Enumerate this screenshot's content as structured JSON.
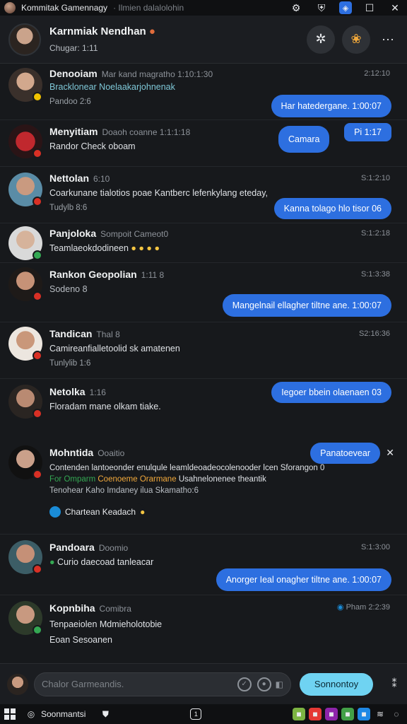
{
  "window": {
    "title": "Kommitak Gamennagy",
    "subtitle": "· Ilmien dalalolohin",
    "controls": [
      "gear-icon",
      "shield-icon",
      "compass-icon",
      "maximize-icon",
      "close-icon"
    ]
  },
  "header": {
    "name": "Karnmiak Nendhan",
    "status": "Chugar: 1:11",
    "actions": [
      "settings-icon",
      "sticker-icon",
      "more-icon"
    ],
    "more_glyph": "···"
  },
  "messages": [
    {
      "name": "Denooiam",
      "meta": "Mar kand magratho 1:10:1:30",
      "time": "2:12:10",
      "text": "Bracklonear Noelaakarjohnenak",
      "sub": "Pandoo 2:6",
      "reply": "Har hatedergane. 1:00:07"
    },
    {
      "name": "Menyitiam",
      "meta": "Doaoh coanne 1:1:1:18",
      "time": "",
      "text": "Randor Check oboam",
      "sub": "",
      "reply": "Camara",
      "reply2": "Pi 1:17"
    },
    {
      "name": "Nettolan",
      "meta": "6:10",
      "time": "S:1:2:10",
      "text": "Coarkunane tialotios poae Kantberc lefenkylang eteday,",
      "sub": "Tudylb 8:6",
      "reply": "Kanna tolago hlo tisor 06"
    },
    {
      "name": "Panjoloka",
      "meta": "Sompoit Cameot0",
      "time": "S:1:2:18",
      "text": "Teamlaeokdodineen",
      "sub": "",
      "reply": ""
    },
    {
      "name": "Rankon Geopolian",
      "meta": "1:11 8",
      "time": "S:1:3:38",
      "text": "Sodeno 8",
      "sub": "",
      "reply": "Mangelnail ellagher tiltne ane. 1:00:07"
    },
    {
      "name": "Tandican",
      "meta": "Thal 8",
      "time": "S2:16:36",
      "text": "Camireanfialletoolid sk amatenen",
      "sub": "Tunlylib 1:6",
      "reply": ""
    },
    {
      "name": "Netolka",
      "meta": "1:16",
      "time": "",
      "text": "Floradam mane olkam tiake.",
      "sub": "",
      "reply": "Iegoer bbein olaenaen 03"
    },
    {
      "name": "Mohntida",
      "meta": "Ooaitio",
      "time": "",
      "text": "Contenden lantoeonder enulqule leamldeoadeocolenooder lcen Sforangon 0",
      "line2a": "For Omparm",
      "line2b": "Coenoeme Orarmane",
      "line2c": "Usahnelonenee theantik",
      "line3": "Tenohear Kaho Imdaney ilua Skamatho:6",
      "pill": "Chartean Keadach",
      "reply": "Panatoevear"
    },
    {
      "name": "Pandoara",
      "meta": "Doomio",
      "time": "S:1:3:00",
      "text": "Curio daecoad tanleacar",
      "sub": "",
      "reply": "Anorger Ieal onagher tiltne ane. 1:00:07"
    },
    {
      "name": "Kopnbiha",
      "meta": "Comibra",
      "time": "2:2:39",
      "text": "Tenpaeiolen Mdmieholotobie",
      "sub": "Eoan Sesoanen",
      "tag": "Pham",
      "reply": ""
    }
  ],
  "composer": {
    "placeholder": "Chalor Garmeandis.",
    "send_label": "Sonnontoy",
    "more_glyph": "⁑"
  },
  "taskbar": {
    "label": "Soonmantsi",
    "tray_icons": [
      "chat-icon",
      "gift-icon",
      "photo-icon",
      "grid-icon",
      "share-icon",
      "wifi-icon",
      "chat-bubble-icon"
    ]
  }
}
